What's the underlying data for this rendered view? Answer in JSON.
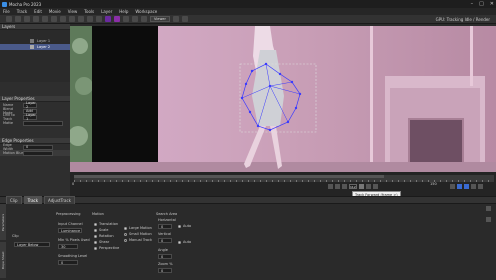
{
  "window": {
    "title": "Mocha Pro 2023"
  },
  "menu": [
    "File",
    "Track",
    "Edit",
    "Movie",
    "View",
    "Tools",
    "Layer",
    "Help",
    "Workspace"
  ],
  "toolbar": {
    "view_mode": "Viewer",
    "right_info": "GPU: Tracking Idle / Render"
  },
  "layers_panel": {
    "title": "Layers",
    "layers": [
      {
        "name": "Layer 1"
      },
      {
        "name": "Layer 2"
      }
    ]
  },
  "layer_properties": {
    "title": "Layer Properties",
    "fields": [
      {
        "label": "Name",
        "value": "Layer 2"
      },
      {
        "label": "Blend Mode",
        "value": "Add"
      },
      {
        "label": "Link to Track",
        "value": "Layer 1"
      },
      {
        "label": "Matte",
        "value": ""
      }
    ]
  },
  "edge_properties": {
    "title": "Edge Properties",
    "fields": [
      {
        "label": "Edge Width",
        "value": "0"
      },
      {
        "label": "Motion Blur",
        "value": ""
      }
    ]
  },
  "timeline": {
    "frame_in": "0",
    "frame_out": "150",
    "current_frame": "112",
    "tooltip": "Track Forward (frame >)"
  },
  "lower_tabs": [
    "Clip",
    "Track",
    "AdjustTrack"
  ],
  "side_tabs": [
    "Parameters",
    "Dope Sheet"
  ],
  "track_params": {
    "clip_section": "Clip",
    "clip_value": "Layer Below",
    "preprocessing_title": "Preprocessing",
    "input_channel_label": "Input Channel",
    "input_channel_value": "Luminance",
    "min_pixels_label": "Min % Pixels Used",
    "min_pixels_value": "30",
    "smoothing_label": "Smoothing Level",
    "smoothing_value": "0",
    "motion_title": "Motion",
    "motion_options": [
      "Translation",
      "Scale",
      "Rotation",
      "Shear",
      "Perspective"
    ],
    "motion_options_2": [
      "Large Motion",
      "Small Motion",
      "Manual Track"
    ],
    "search_title": "Search Area",
    "horizontal_label": "Horizontal",
    "vertical_label": "Vertical",
    "angle_label": "Angle",
    "zoom_label": "Zoom %",
    "auto_label": "Auto",
    "horizontal_value": "0",
    "vertical_value": "0",
    "angle_value": "0",
    "zoom_value": "0"
  },
  "colors": {
    "accent": "#8b2fa8",
    "spline": "#3a3aff",
    "matte": "#c8a6b6"
  }
}
